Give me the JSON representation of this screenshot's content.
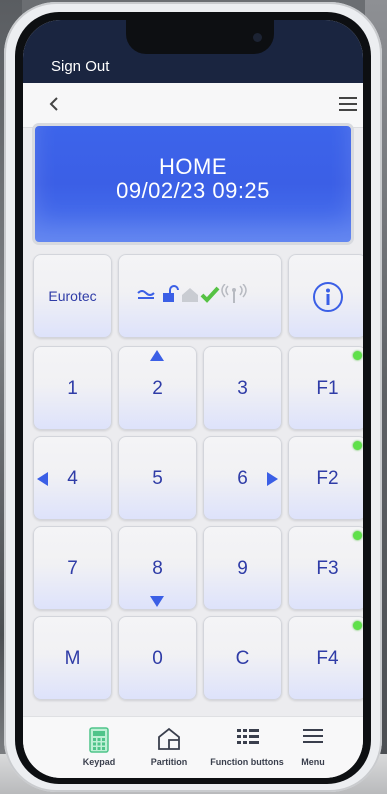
{
  "header": {
    "sign_out_label": "Sign Out"
  },
  "display": {
    "line1": "HOME",
    "line2": "09/02/23  09:25"
  },
  "status_keys": {
    "brand_label": "Eurotec",
    "status_icons": [
      "ac-power-icon",
      "unlocked-icon",
      "home-icon",
      "check-icon",
      "wireless-signal-icon"
    ],
    "info_icon": "info-icon"
  },
  "keypad": {
    "rows": [
      [
        {
          "label": "1"
        },
        {
          "label": "2"
        },
        {
          "label": "3"
        },
        {
          "label": "F1"
        }
      ],
      [
        {
          "label": "4"
        },
        {
          "label": "5"
        },
        {
          "label": "6"
        },
        {
          "label": "F2"
        }
      ],
      [
        {
          "label": "7"
        },
        {
          "label": "8"
        },
        {
          "label": "9"
        },
        {
          "label": "F3"
        }
      ],
      [
        {
          "label": "M"
        },
        {
          "label": "0"
        },
        {
          "label": "C"
        },
        {
          "label": "F4"
        }
      ]
    ]
  },
  "tabs": [
    {
      "label": "Keypad",
      "active": true
    },
    {
      "label": "Partition",
      "active": false
    },
    {
      "label": "Function buttons",
      "active": false
    },
    {
      "label": "Menu",
      "active": false
    }
  ],
  "colors": {
    "accent": "#3b5fe6",
    "key_text": "#2f3ca7",
    "led": "#5fe04a",
    "active_tab": "#4fc48a",
    "header": "#1a2540"
  }
}
